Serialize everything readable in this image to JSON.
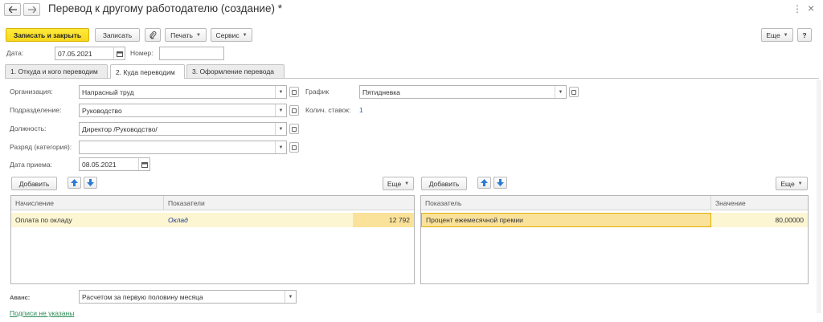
{
  "window": {
    "title": "Перевод к другому работодателю (создание) *",
    "menu_dots": "⋮",
    "close": "×"
  },
  "toolbar": {
    "save_close": "Записать и закрыть",
    "save": "Записать",
    "print": "Печать",
    "service": "Сервис",
    "more": "Еще",
    "help": "?"
  },
  "header": {
    "date_label": "Дата:",
    "date_value": "07.05.2021",
    "number_label": "Номер:",
    "number_value": ""
  },
  "tabs": [
    {
      "label": "1. Откуда и кого переводим"
    },
    {
      "label": "2. Куда переводим"
    },
    {
      "label": "3. Оформление перевода"
    }
  ],
  "form": {
    "org_label": "Организация:",
    "org_value": "Напрасный труд",
    "dept_label": "Подразделение:",
    "dept_value": "Руководство",
    "position_label": "Должность:",
    "position_value": "Директор /Руководство/",
    "grade_label": "Разряд (категория):",
    "grade_value": "",
    "hire_date_label": "Дата приема:",
    "hire_date_value": "08.05.2021",
    "schedule_label": "График",
    "schedule_value": "Пятидневка",
    "rates_label": "Колич. ставок:",
    "rates_value": "1"
  },
  "left_panel": {
    "add": "Добавить",
    "more": "Еще",
    "columns": [
      "Начисление",
      "Показатели"
    ],
    "rows": [
      {
        "accrual": "Оплата по окладу",
        "indicator": "Оклад",
        "amount": "12 792"
      }
    ]
  },
  "right_panel": {
    "add": "Добавить",
    "more": "Еще",
    "columns": [
      "Показатель",
      "Значение"
    ],
    "rows": [
      {
        "indicator": "Процент ежемесячной премии",
        "value": "80,00000"
      }
    ]
  },
  "footer": {
    "advance_label": "Аванс:",
    "advance_value": "Расчетом за первую половину месяца",
    "signatures_link": "Подписи не указаны"
  }
}
